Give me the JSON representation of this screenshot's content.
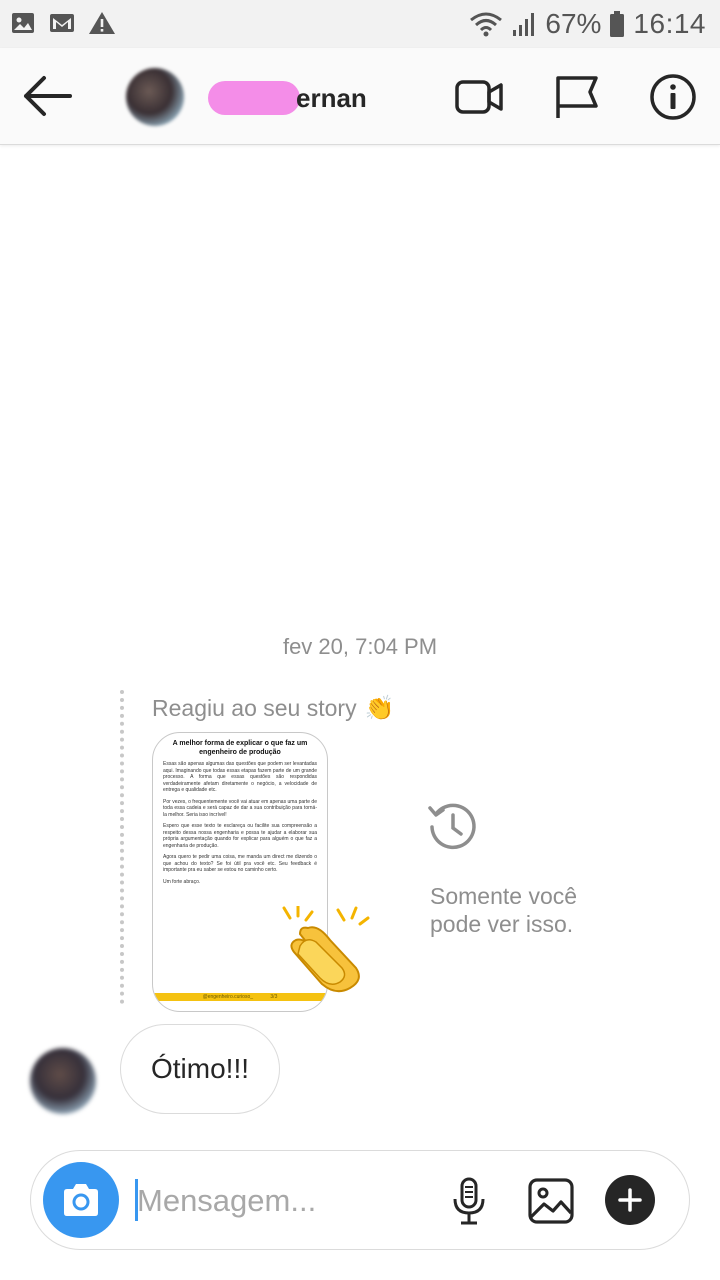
{
  "status_bar": {
    "battery": "67%",
    "time": "16:14",
    "icons": [
      "image-icon",
      "gmail-icon",
      "warning-icon",
      "wifi-icon",
      "signal-icon",
      "battery-icon"
    ]
  },
  "header": {
    "username_visible": "ernan",
    "icons": [
      "back-arrow-icon",
      "video-call-icon",
      "flag-icon",
      "info-icon"
    ]
  },
  "chat": {
    "date_separator": "fev 20, 7:04 PM",
    "story_reaction": {
      "label": "Reagiu ao seu story",
      "reaction_emoji": "👏",
      "story_title": "A melhor forma de explicar o que faz um engenheiro de produção",
      "story_paragraphs": [
        "Essas são apenas algumas das questões que podem ser levantadas aqui. Imaginando que todas essas etapas fazem parte de um grande processo. A forma que essas questões são respondidas verdadeiramente afetam diretamente o negócio, a velocidade de entrega e qualidade etc.",
        "Por vezes, o frequentemente você vai atuar em apenas uma parte de toda essa cadeia e será capaz de dar a sua contribuição para torná-la melhor. Seria isso incrível!",
        "Espero que esse texto te esclareça ou facilite sua compreensão a respeito dessa nossa engenharia e possa te ajudar a elaborar sua própria argumentação quando for explicar para alguém o que faz a engenharia de produção.",
        "Agora quero te pedir uma coisa, me manda um direct me dizendo o que achou do texto? Se foi útil pra você etc. Seu feedback é importante pra eu saber se estou no caminho certo.",
        "Um forte abraço."
      ],
      "story_footer": "@engenheiro.curioso_",
      "story_page": "3/3",
      "visibility_note": "Somente você pode ver isso."
    },
    "messages": [
      {
        "text": "Ótimo!!!"
      }
    ]
  },
  "composer": {
    "placeholder": "Mensagem...",
    "value": ""
  },
  "colors": {
    "accent": "#3897f0",
    "redaction": "#f48de8",
    "story_footer": "#f5c211"
  }
}
